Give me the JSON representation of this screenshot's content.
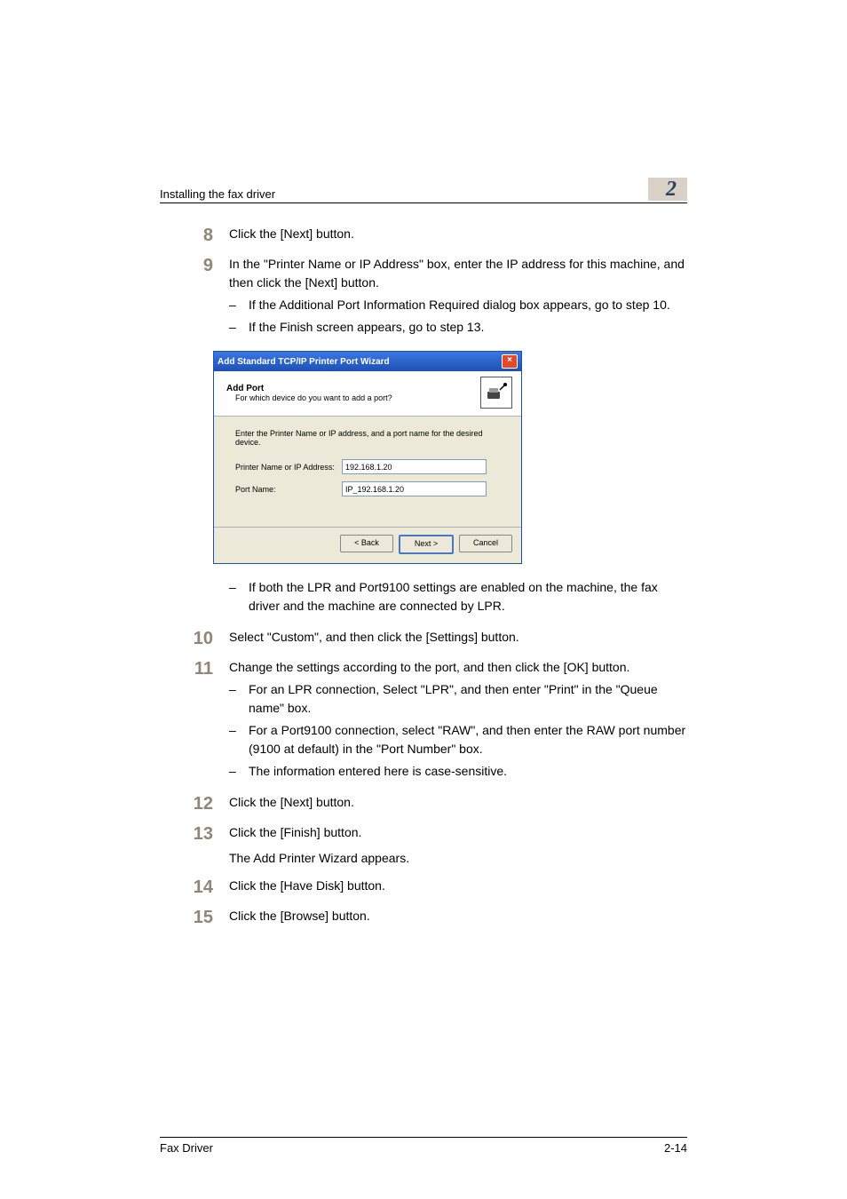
{
  "header": {
    "title": "Installing the fax driver",
    "chapter": "2"
  },
  "steps": {
    "s8": {
      "num": "8",
      "text": "Click the [Next] button."
    },
    "s9": {
      "num": "9",
      "text": "In the \"Printer Name or IP Address\" box, enter the IP address for this machine, and then click the [Next] button.",
      "sub1": "If the Additional Port Information Required dialog box appears, go to step 10.",
      "sub2": "If the Finish screen appears, go to step 13.",
      "sub3": "If both the LPR and Port9100 settings are enabled on the machine, the fax driver and the machine are connected by LPR."
    },
    "s10": {
      "num": "10",
      "text": "Select \"Custom\", and then click the [Settings] button."
    },
    "s11": {
      "num": "11",
      "text": "Change the settings according to the port, and then click the [OK] button.",
      "sub1": "For an LPR connection, Select \"LPR\", and then enter \"Print\" in the \"Queue name\" box.",
      "sub2": "For a Port9100 connection, select \"RAW\", and then enter the RAW port number (9100 at default) in the \"Port Number\" box.",
      "sub3": "The information entered here is case-sensitive."
    },
    "s12": {
      "num": "12",
      "text": "Click the [Next] button."
    },
    "s13": {
      "num": "13",
      "text": "Click the [Finish] button.",
      "after": "The Add Printer Wizard appears."
    },
    "s14": {
      "num": "14",
      "text": "Click the [Have Disk] button."
    },
    "s15": {
      "num": "15",
      "text": "Click the [Browse] button."
    }
  },
  "dialog": {
    "title": "Add Standard TCP/IP Printer Port Wizard",
    "close": "×",
    "heading": "Add Port",
    "subheading": "For which device do you want to add a port?",
    "instruction": "Enter the Printer Name or IP address, and a port name for the desired device.",
    "field1_label": "Printer Name or IP Address:",
    "field1_value": "192.168.1.20",
    "field2_label": "Port Name:",
    "field2_value": "IP_192.168.1.20",
    "btn_back": "< Back",
    "btn_next": "Next >",
    "btn_cancel": "Cancel"
  },
  "footer": {
    "left": "Fax Driver",
    "right": "2-14"
  }
}
